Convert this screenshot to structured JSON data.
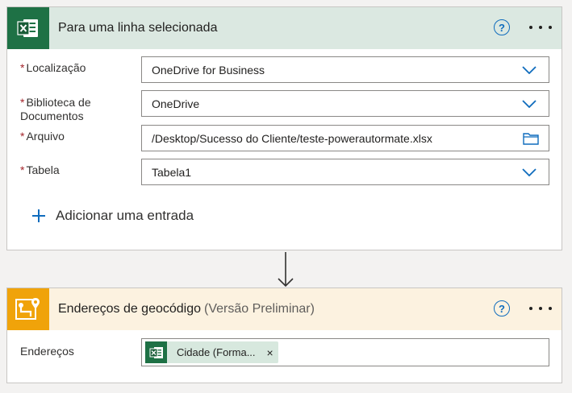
{
  "card1": {
    "title": "Para uma linha selecionada",
    "help": "?",
    "fields": [
      {
        "label": "Localização",
        "value": "OneDrive for Business"
      },
      {
        "label_line1": "Biblioteca de",
        "label_line2": "Documentos",
        "value": "OneDrive"
      },
      {
        "label": "Arquivo",
        "value": "/Desktop/Sucesso do Cliente/teste-powerautormate.xlsx"
      },
      {
        "label": "Tabela",
        "value": "Tabela1"
      }
    ],
    "required_marker": "*",
    "add_entry": "Adicionar uma entrada"
  },
  "card2": {
    "title": "Endereços de geocódigo",
    "subtitle": "(Versão Preliminar)",
    "help": "?",
    "field_label": "Endereços",
    "token_label": "Cidade (Forma...",
    "token_close": "×"
  },
  "colors": {
    "excel_green": "#1e7145",
    "maps_orange": "#f0a30a",
    "accent_blue": "#0f6cbd",
    "required_red": "#a4262c"
  },
  "icons": {
    "excel": "excel-icon",
    "maps": "maps-icon",
    "help": "help-circle-icon",
    "more": "more-horizontal-icon",
    "chevron": "chevron-down-icon",
    "folder": "folder-icon",
    "plus": "plus-icon",
    "arrow": "arrow-down-icon"
  }
}
